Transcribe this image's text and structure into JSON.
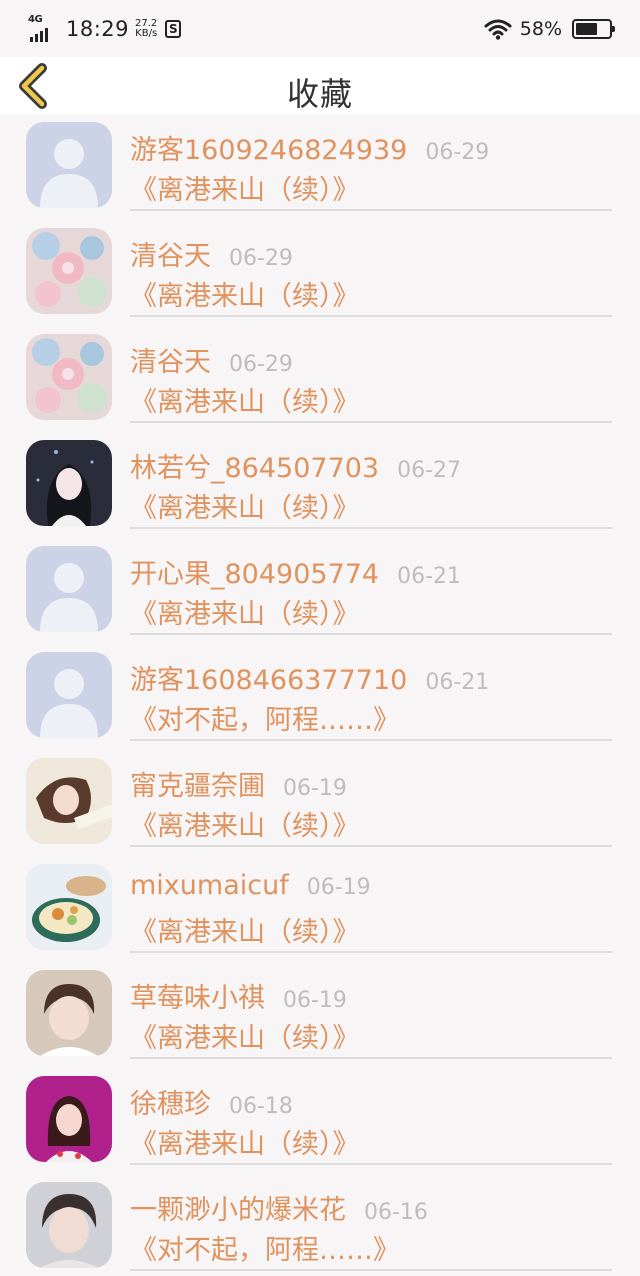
{
  "status_bar": {
    "network": "4G",
    "time": "18:29",
    "speed_value": "27.2",
    "speed_unit": "KB/s",
    "battery": "58%"
  },
  "nav": {
    "title": "收藏"
  },
  "items": [
    {
      "name": "游客1609246824939",
      "date": "06-29",
      "title": "《离港来山（续）》",
      "avatar": "default-avatar"
    },
    {
      "name": "清谷天",
      "date": "06-29",
      "title": "《离港来山（续）》",
      "avatar": "floral-avatar"
    },
    {
      "name": "清谷天",
      "date": "06-29",
      "title": "《离港来山（续）》",
      "avatar": "floral-avatar"
    },
    {
      "name": "林若兮_864507703",
      "date": "06-27",
      "title": "《离港来山（续）》",
      "avatar": "girl-dark-avatar"
    },
    {
      "name": "开心果_804905774",
      "date": "06-21",
      "title": "《离港来山（续）》",
      "avatar": "default-avatar"
    },
    {
      "name": "游客1608466377710",
      "date": "06-21",
      "title": "《对不起，阿程……》",
      "avatar": "default-avatar"
    },
    {
      "name": "甯克疆奈圃",
      "date": "06-19",
      "title": "《离港来山（续）》",
      "avatar": "girl-light-avatar"
    },
    {
      "name": "mixumaicuf",
      "date": "06-19",
      "title": "《离港来山（续）》",
      "avatar": "food-avatar"
    },
    {
      "name": "草莓味小祺",
      "date": "06-19",
      "title": "《离港来山（续）》",
      "avatar": "boy-avatar"
    },
    {
      "name": "徐穗珍",
      "date": "06-18",
      "title": "《离港来山（续）》",
      "avatar": "girl-magenta-avatar"
    },
    {
      "name": "一颗渺小的爆米花",
      "date": "06-16",
      "title": "《对不起，阿程……》",
      "avatar": "boy-avatar-2"
    }
  ]
}
